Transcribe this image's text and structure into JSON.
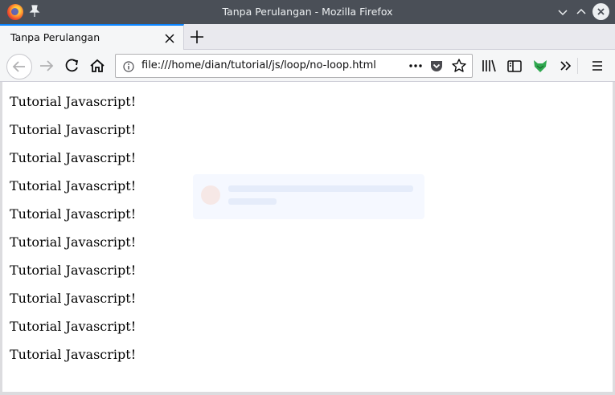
{
  "window": {
    "title": "Tanpa Perulangan - Mozilla Firefox"
  },
  "tabs": [
    {
      "label": "Tanpa Perulangan",
      "active": true
    }
  ],
  "navbar": {
    "url": "file:///home/dian/tutorial/js/loop/no-loop.html"
  },
  "icons": {
    "titlebar": [
      "firefox-logo",
      "pin-icon",
      "minimize-icon",
      "maximize-icon",
      "close-window-icon"
    ],
    "navbar": [
      "back-icon",
      "forward-icon",
      "reload-icon",
      "home-icon",
      "info-icon",
      "more-actions-icon",
      "pocket-icon",
      "bookmark-star-icon",
      "library-icon",
      "sidebar-icon",
      "extension-fox-icon",
      "overflow-icon",
      "hamburger-menu-icon"
    ]
  },
  "colors": {
    "titlebar": "#4a4f57",
    "tab_accent": "#0a84ff",
    "toolbar": "#f5f6f7",
    "extension_fox": "#2fa84f"
  },
  "content": {
    "lines": [
      "Tutorial Javascript!",
      "Tutorial Javascript!",
      "Tutorial Javascript!",
      "Tutorial Javascript!",
      "Tutorial Javascript!",
      "Tutorial Javascript!",
      "Tutorial Javascript!",
      "Tutorial Javascript!",
      "Tutorial Javascript!",
      "Tutorial Javascript!"
    ]
  }
}
